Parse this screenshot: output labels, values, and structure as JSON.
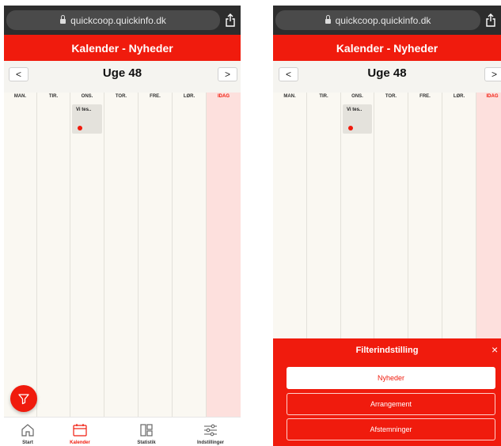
{
  "url": "quickcoop.quickinfo.dk",
  "title": "Kalender - Nyheder",
  "week_label": "Uge 48",
  "prev_label": "<",
  "next_label": ">",
  "days": [
    "MAN.",
    "TIR.",
    "ONS.",
    "TOR.",
    "FRE.",
    "LØR.",
    "IDAG"
  ],
  "event": {
    "title": "Vi tes..",
    "day": "ONS."
  },
  "bottom_nav": [
    {
      "label": "Start",
      "icon": "home-icon"
    },
    {
      "label": "Kalender",
      "icon": "calendar-icon",
      "active": true
    },
    {
      "label": "Statistik",
      "icon": "statistics-icon"
    },
    {
      "label": "Indstillinger",
      "icon": "sliders-icon"
    }
  ],
  "fab_icon": "filter-icon",
  "filter": {
    "title": "Filterindstilling",
    "close": "×",
    "options": [
      {
        "label": "Nyheder",
        "selected": true
      },
      {
        "label": "Arrangement",
        "selected": false
      },
      {
        "label": "Afstemninger",
        "selected": false
      }
    ]
  },
  "colors": {
    "accent": "#f01b0d",
    "today_bg": "#fde0dd",
    "calendar_bg": "#faf8f2"
  }
}
